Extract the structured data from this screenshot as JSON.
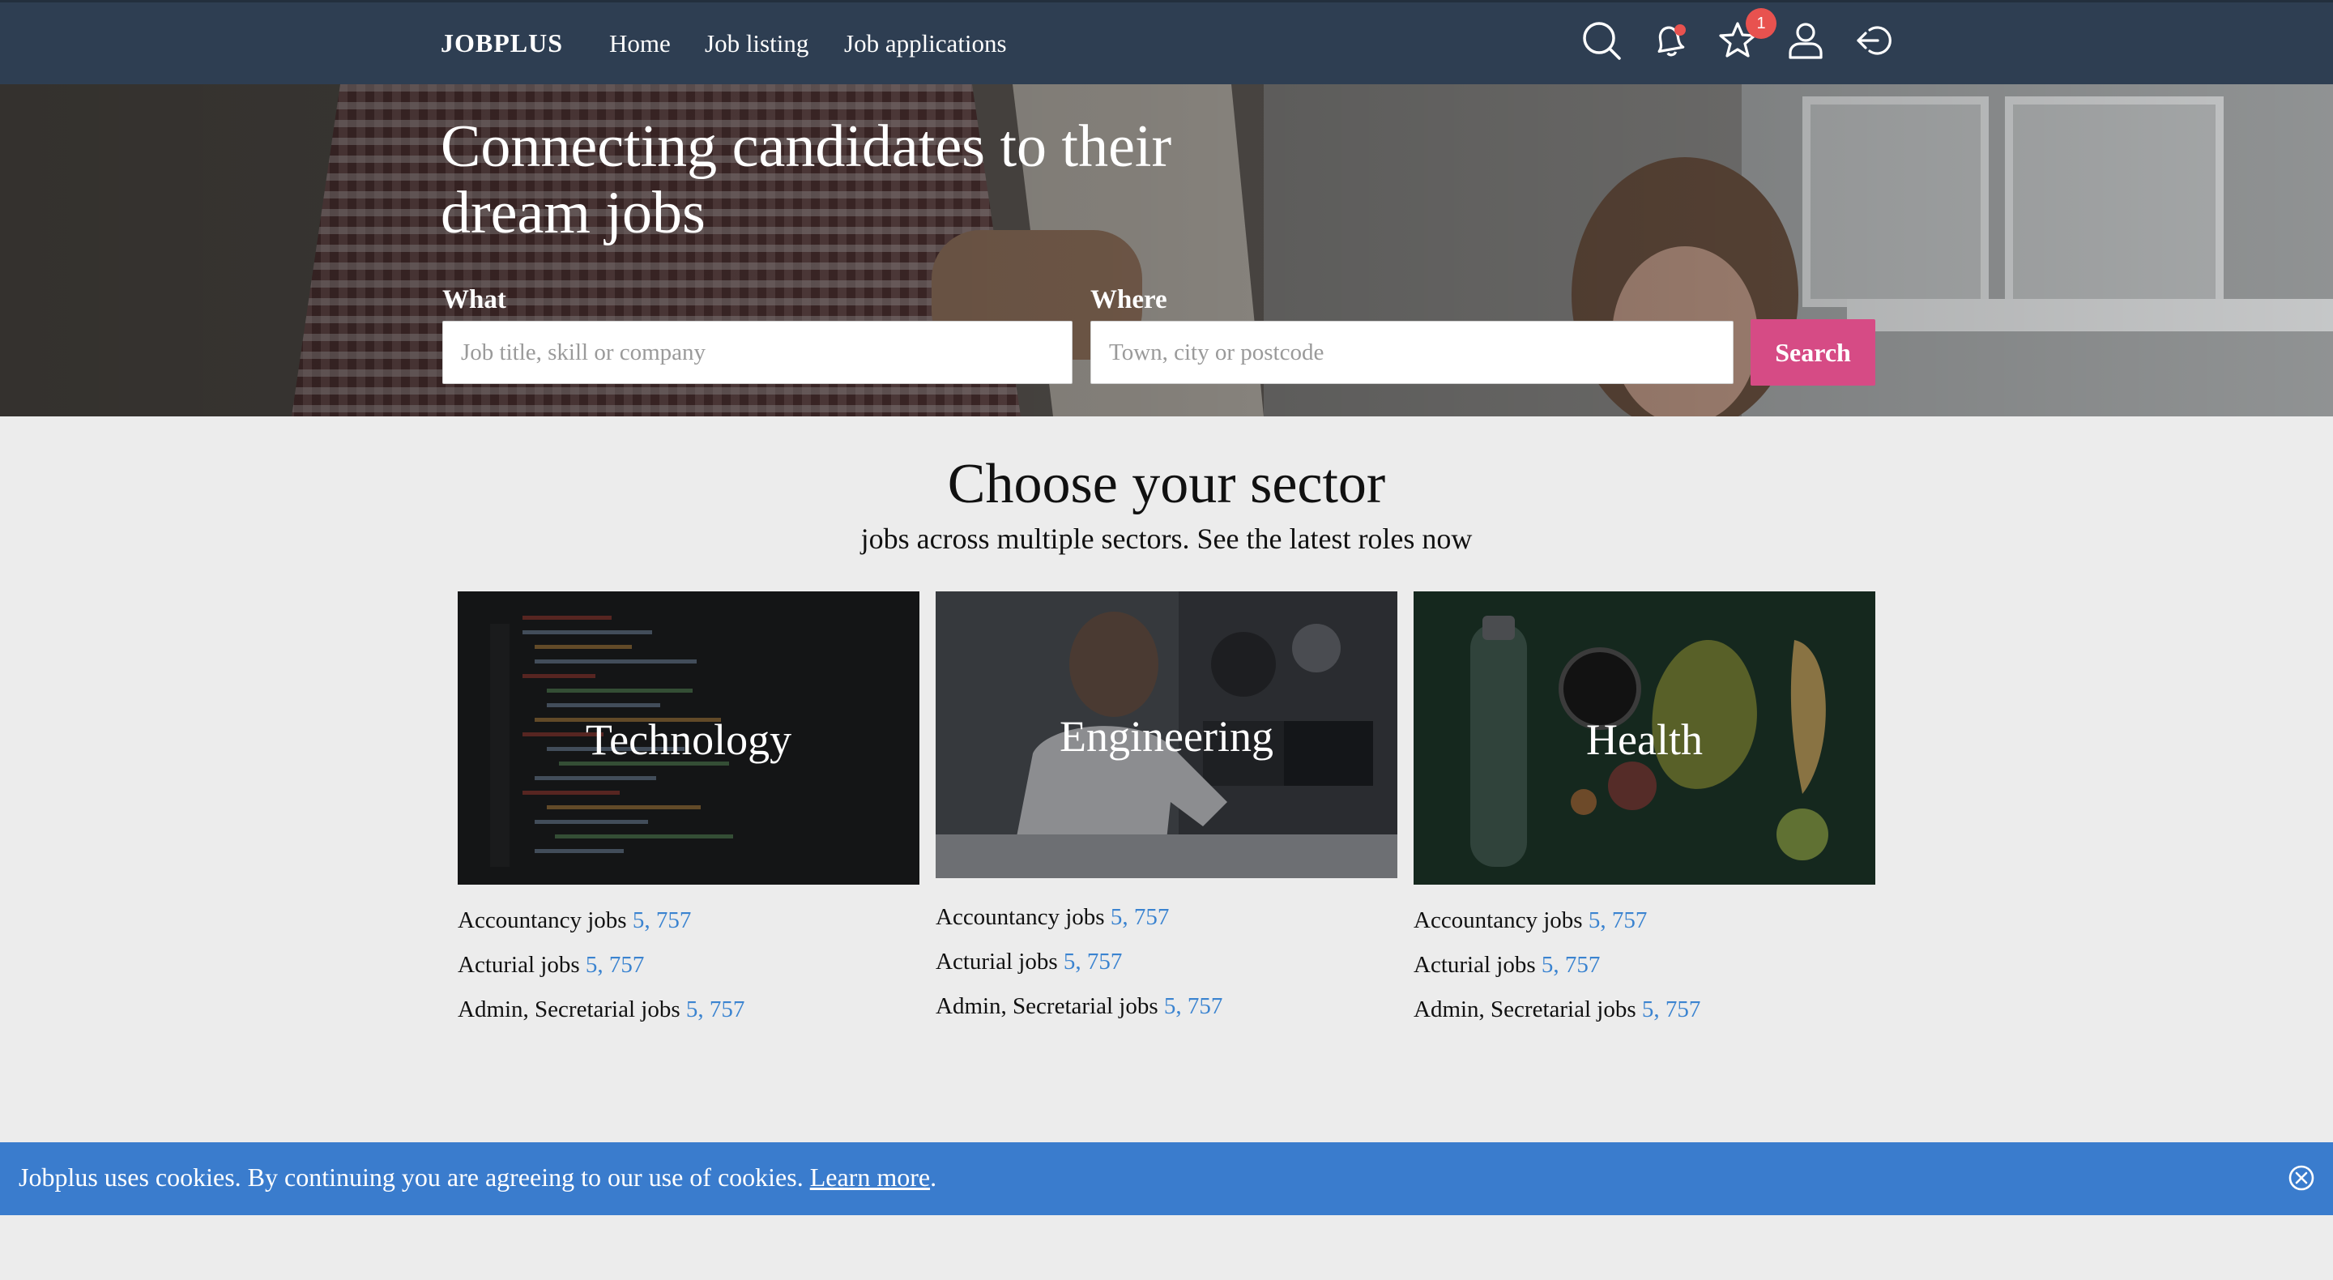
{
  "nav": {
    "brand": "JOBPLUS",
    "links": [
      "Home",
      "Job listing",
      "Job applications"
    ],
    "icons": [
      "search-icon",
      "bell-icon",
      "star-icon",
      "user-icon",
      "logout-icon"
    ],
    "favorites_badge": "1"
  },
  "hero": {
    "title": "Connecting candidates to their dream jobs",
    "what_label": "What",
    "what_placeholder": "Job title, skill or company",
    "where_label": "Where",
    "where_placeholder": "Town, city or postcode",
    "search_label": "Search"
  },
  "sectors": {
    "title": "Choose your sector",
    "subtitle": "jobs across multiple sectors. See the latest roles now",
    "cards": [
      {
        "name": "Technology",
        "jobs": [
          {
            "label": "Accountancy jobs",
            "count": "5, 757"
          },
          {
            "label": "Acturial jobs",
            "count": "5, 757"
          },
          {
            "label": "Admin, Secretarial jobs",
            "count": "5, 757"
          }
        ]
      },
      {
        "name": "Engineering",
        "jobs": [
          {
            "label": "Accountancy jobs",
            "count": "5, 757"
          },
          {
            "label": "Acturial jobs",
            "count": "5, 757"
          },
          {
            "label": "Admin, Secretarial jobs",
            "count": "5, 757"
          }
        ]
      },
      {
        "name": "Health",
        "jobs": [
          {
            "label": "Accountancy jobs",
            "count": "5, 757"
          },
          {
            "label": "Acturial jobs",
            "count": "5, 757"
          },
          {
            "label": "Admin, Secretarial jobs",
            "count": "5, 757"
          }
        ]
      }
    ]
  },
  "cookie": {
    "text": "Jobplus uses cookies. By continuing you are agreeing to our use of cookies.",
    "link": "Learn more",
    "end": "."
  },
  "colors": {
    "navbar": "#2e3e52",
    "accent": "#d64b85",
    "link_blue": "#3a83d0",
    "cookie_bar": "#3a7ccd",
    "badge": "#e8524f"
  }
}
